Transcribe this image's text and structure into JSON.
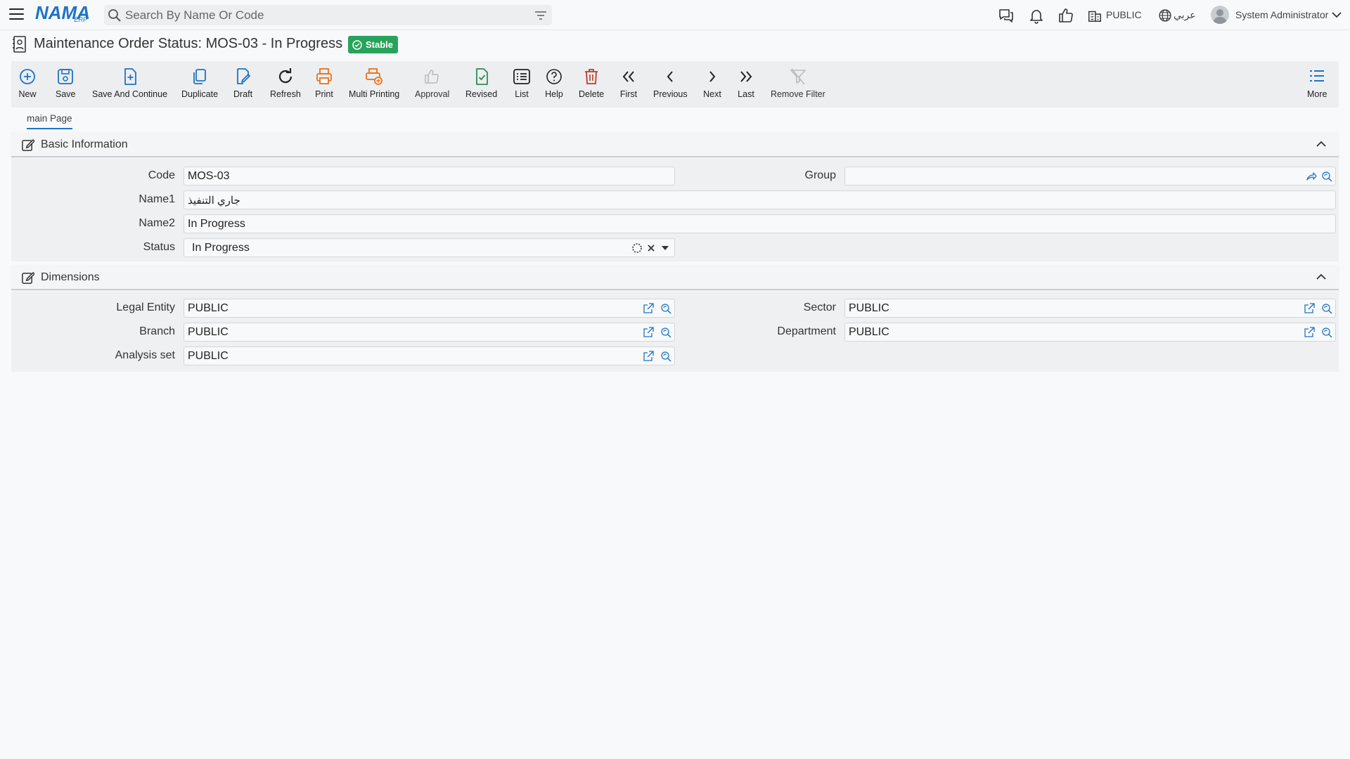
{
  "app": {
    "logo_main": "NAMA",
    "logo_sub": "ERP"
  },
  "search": {
    "placeholder": "Search By Name Or Code"
  },
  "header": {
    "company": "PUBLIC",
    "language": "عربي",
    "user": "System Administrator"
  },
  "page": {
    "title": "Maintenance Order Status: MOS-03 - In Progress",
    "status_badge": "Stable",
    "badge_color": "#28a35b"
  },
  "toolbar": {
    "new": "New",
    "save": "Save",
    "save_continue": "Save And Continue",
    "duplicate": "Duplicate",
    "draft": "Draft",
    "refresh": "Refresh",
    "print": "Print",
    "multi_printing": "Multi Printing",
    "approval": "Approval",
    "revised": "Revised",
    "list": "List",
    "help": "Help",
    "delete": "Delete",
    "first": "First",
    "previous": "Previous",
    "next": "Next",
    "last": "Last",
    "remove_filter": "Remove Filter",
    "more": "More"
  },
  "tabs": {
    "main": "main Page"
  },
  "basic": {
    "title": "Basic Information",
    "code_label": "Code",
    "code_value": "MOS-03",
    "group_label": "Group",
    "group_value": "",
    "name1_label": "Name1",
    "name1_value": "جاري التنفيذ",
    "name2_label": "Name2",
    "name2_value": "In Progress",
    "status_label": "Status",
    "status_value": "In Progress"
  },
  "dimensions": {
    "title": "Dimensions",
    "legal_entity_label": "Legal Entity",
    "legal_entity_value": "PUBLIC",
    "sector_label": "Sector",
    "sector_value": "PUBLIC",
    "branch_label": "Branch",
    "branch_value": "PUBLIC",
    "department_label": "Department",
    "department_value": "PUBLIC",
    "analysis_label": "Analysis set",
    "analysis_value": "PUBLIC"
  },
  "colors": {
    "accent": "#1d73c7",
    "print": "#e8711e",
    "delete": "#c0392b",
    "revised": "#2e8b57"
  }
}
